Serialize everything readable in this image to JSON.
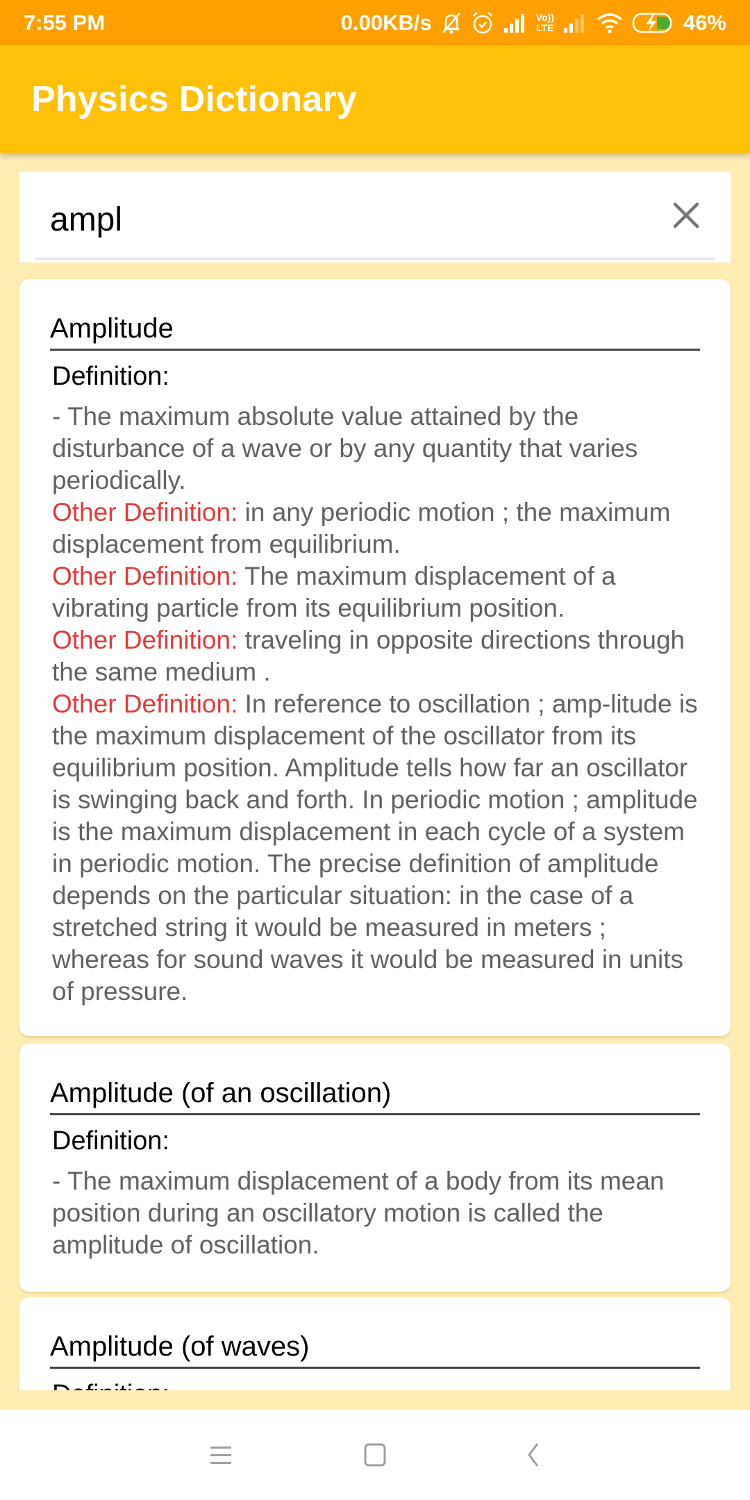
{
  "status_bar": {
    "time": "7:55 PM",
    "network_speed": "0.00KB/s",
    "icons": [
      "bell-muted-icon",
      "alarm-icon",
      "signal-icon",
      "volte-icon",
      "signal-weak-icon",
      "wifi-icon",
      "battery-charging-icon"
    ],
    "volte_top": "Vo))",
    "volte_bottom": "LTE",
    "battery_percent": "46%",
    "battery_level": 0.46
  },
  "app_bar": {
    "title": "Physics Dictionary"
  },
  "search": {
    "value": "ampl",
    "placeholder": "",
    "clear_icon": "close-icon"
  },
  "colors": {
    "status_bar": "#FFA000",
    "app_bar": "#FFC107",
    "background": "#FFECB3",
    "other_definition_label": "#E53935",
    "body_text": "#616161"
  },
  "results": [
    {
      "term": "Amplitude",
      "definition_label": "Definition:",
      "definition": "- The maximum absolute value attained by the disturbance of a wave or by any quantity that varies periodically.",
      "other_definitions": [
        {
          "label": "Other Definition:",
          "text": " in any periodic motion ; the maximum displacement from equilibrium."
        },
        {
          "label": "Other Definition:",
          "text": " The maximum displacement of a vibrating particle from its equilibrium position."
        },
        {
          "label": "Other Definition:",
          "text": " traveling in opposite directions through the same medium ."
        },
        {
          "label": "Other Definition:",
          "text": " In reference to oscillation ; amp-litude is the maximum displacement of the oscillator from its equilibrium position. Amplitude tells how far an oscillator is swinging back and forth. In periodic motion ; amplitude is the maximum displacement in each cycle of a system in periodic motion. The precise definition of amplitude depends on the particular situation: in the case of a stretched string it would be measured in meters ; whereas for sound waves it would be measured in units of pressure."
        }
      ]
    },
    {
      "term": "Amplitude (of an oscillation)",
      "definition_label": "Definition:",
      "definition": "- The maximum displacement of a body from its mean position during an oscillatory motion is called the amplitude of oscillation."
    },
    {
      "term": "Amplitude (of waves)",
      "definition_label": "Definition:"
    }
  ],
  "nav_bar": {
    "buttons": [
      "menu-icon",
      "home-icon",
      "back-icon"
    ]
  }
}
